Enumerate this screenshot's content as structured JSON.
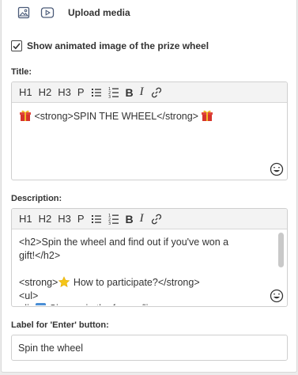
{
  "upload": {
    "label": "Upload media",
    "icons": [
      "image-icon",
      "video-icon"
    ]
  },
  "animated_checkbox": {
    "label": "Show animated image of the prize wheel",
    "checked": true
  },
  "title_field": {
    "label": "Title:",
    "toolbar": [
      "H1",
      "H2",
      "H3",
      "P",
      "bullet-list-icon",
      "numbered-list-icon",
      "B",
      "I",
      "link-icon"
    ],
    "value_text": "<strong>SPIN THE WHEEL</strong>"
  },
  "description_field": {
    "label": "Description:",
    "toolbar": [
      "H1",
      "H2",
      "H3",
      "P",
      "bullet-list-icon",
      "numbered-list-icon",
      "B",
      "I",
      "link-icon"
    ],
    "lines": [
      "<h2>Spin the wheel and find out if you've won a",
      "gift!</h2>",
      "",
      " How to participate?</strong>",
      "<ul>",
      "<li> Sign up in the form </li>"
    ],
    "line4_prefix": "<strong>"
  },
  "enter_button_field": {
    "label": "Label for 'Enter' button:",
    "value": "Spin the wheel"
  },
  "tb_labels": {
    "h1": "H1",
    "h2": "H2",
    "h3": "H3",
    "p": "P",
    "b": "B",
    "i": "I"
  },
  "colors": {
    "accent_icon": "#4a5a78",
    "border": "#cfcfcf",
    "toolbar_bg": "#f3f3f3",
    "star": "#f5c518",
    "gift_red": "#d6342c",
    "gift_yellow": "#f2b92b",
    "keycap_blue": "#4b8fd6"
  }
}
